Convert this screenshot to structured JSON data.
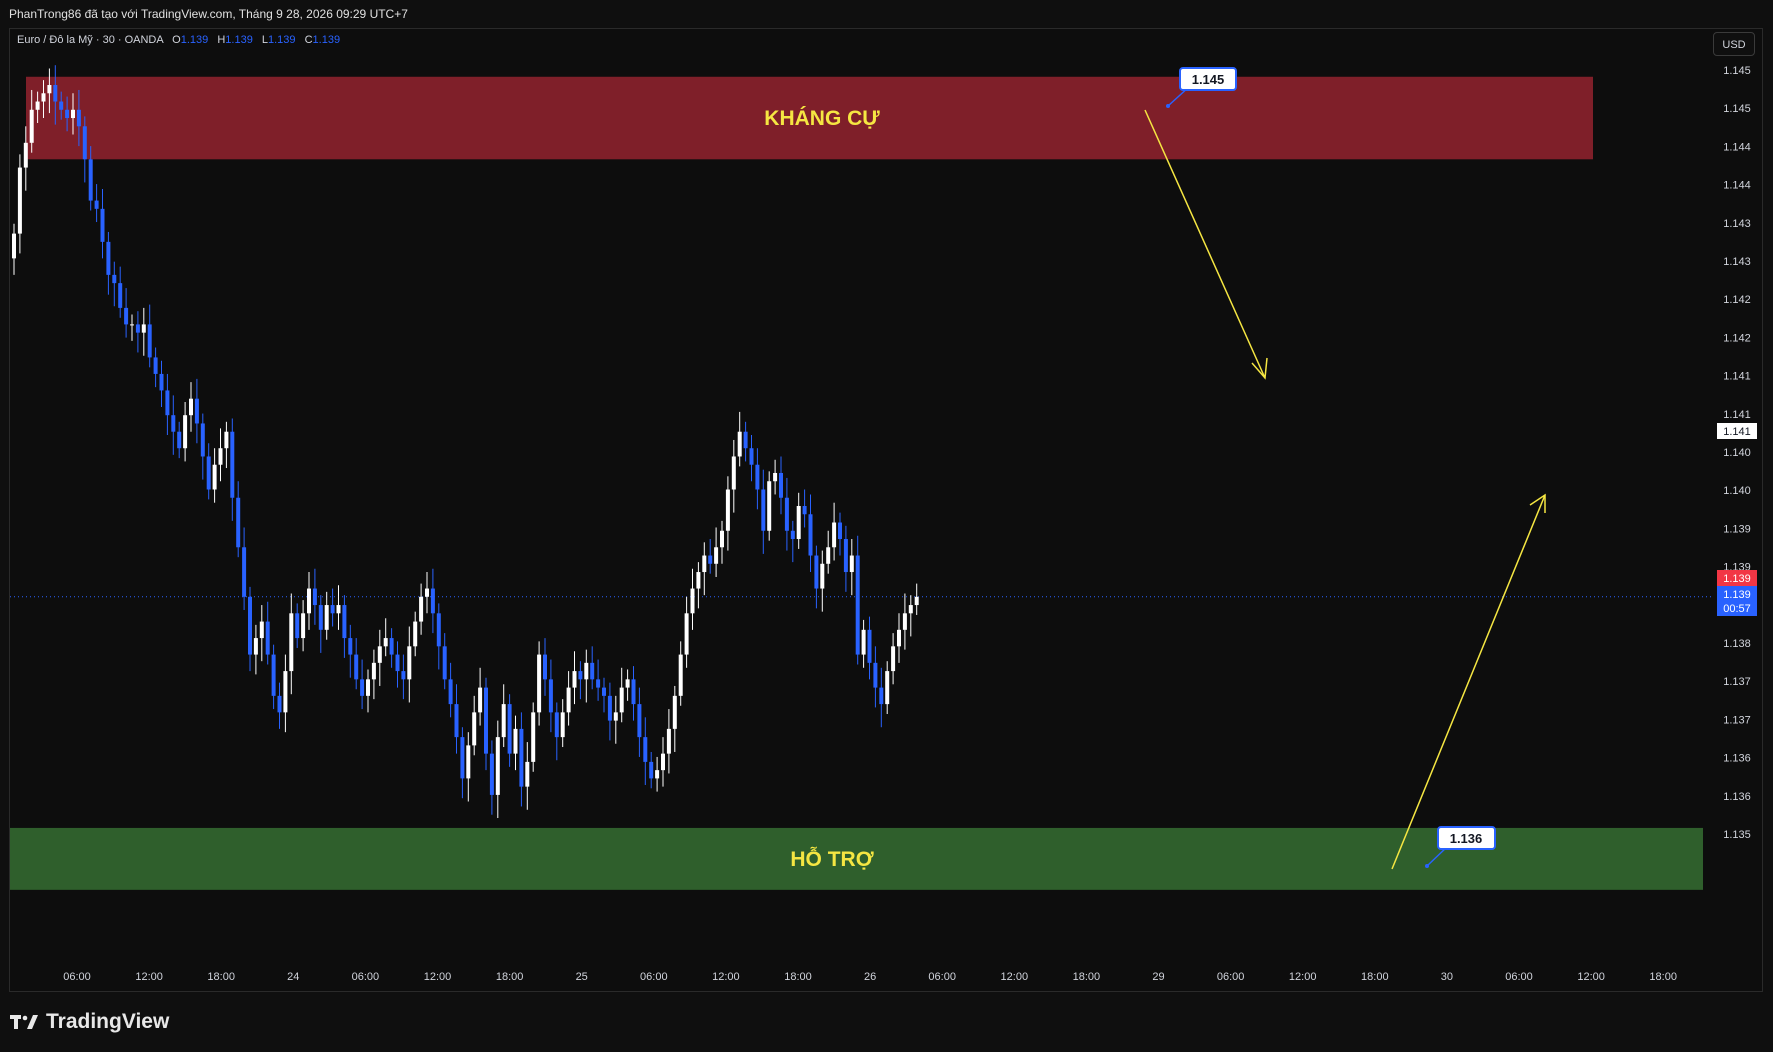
{
  "header": {
    "attribution": "PhanTrong86 đã tạo với TradingView.com, Tháng 9 28, 2026 09:29 UTC+7"
  },
  "legend": {
    "symbol": "Euro / Đô la Mỹ · 30 · OANDA",
    "o_label": "O",
    "o_value": "1.139",
    "h_label": "H",
    "h_value": "1.139",
    "l_label": "L",
    "l_value": "1.139",
    "c_label": "C",
    "c_value": "1.139"
  },
  "currency_button": "USD",
  "brand": "TradingView",
  "zones": {
    "resistance": {
      "label": "KHÁNG CỰ",
      "top": 1.1455,
      "bottom": 1.1445,
      "color": "#7f1f29"
    },
    "support": {
      "label": "HỖ TRỢ",
      "top": 1.1364,
      "bottom": 1.13565,
      "color": "#2f5f2c"
    }
  },
  "callouts": {
    "resistance_price": "1.145",
    "support_price": "1.136"
  },
  "price_scale": {
    "ticks": [
      "1.145",
      "1.145",
      "1.144",
      "1.144",
      "1.143",
      "1.143",
      "1.142",
      "1.142",
      "1.141",
      "1.141",
      "1.140",
      "1.140",
      "1.139",
      "1.139",
      "1.138",
      "1.138",
      "1.137",
      "1.137",
      "1.136",
      "1.136",
      "1.135"
    ],
    "crosshair_label": "1.141",
    "last_price_label": "1.139",
    "current_price_label": "1.139",
    "countdown": "00:57"
  },
  "time_scale": {
    "ticks": [
      "06:00",
      "12:00",
      "18:00",
      "24",
      "06:00",
      "12:00",
      "18:00",
      "25",
      "06:00",
      "12:00",
      "18:00",
      "26",
      "06:00",
      "12:00",
      "18:00",
      "29",
      "06:00",
      "12:00",
      "18:00",
      "30",
      "06:00",
      "12:00",
      "18:00"
    ]
  },
  "colors": {
    "up": "#ffffff",
    "down": "#2962ff",
    "arrow": "#f5e642",
    "zone_text": "#f5e642",
    "last_price_bg": "#f23645",
    "current_price_bg": "#2962ff"
  },
  "chart_data": {
    "type": "candlestick",
    "symbol": "EUR/USD",
    "timeframe": "30",
    "ylim": [
      1.1348,
      1.1458
    ],
    "closes": [
      1.1436,
      1.1444,
      1.1447,
      1.1451,
      1.1452,
      1.1453,
      1.1454,
      1.1452,
      1.1451,
      1.145,
      1.1451,
      1.1449,
      1.1445,
      1.144,
      1.1439,
      1.1435,
      1.1431,
      1.143,
      1.1427,
      1.1425,
      1.1425,
      1.1424,
      1.1425,
      1.1421,
      1.1419,
      1.1417,
      1.1414,
      1.1412,
      1.141,
      1.1414,
      1.1416,
      1.1413,
      1.1409,
      1.1405,
      1.1408,
      1.141,
      1.1412,
      1.1404,
      1.1398,
      1.1392,
      1.1385,
      1.1387,
      1.1389,
      1.1385,
      1.138,
      1.1378,
      1.1383,
      1.139,
      1.1387,
      1.139,
      1.1393,
      1.1391,
      1.1388,
      1.1391,
      1.139,
      1.1391,
      1.1387,
      1.1385,
      1.1382,
      1.138,
      1.1382,
      1.1384,
      1.1386,
      1.1387,
      1.1385,
      1.1383,
      1.1382,
      1.1386,
      1.1389,
      1.1392,
      1.1393,
      1.139,
      1.1386,
      1.1382,
      1.1379,
      1.1375,
      1.137,
      1.1374,
      1.1378,
      1.1381,
      1.1373,
      1.1368,
      1.1375,
      1.1379,
      1.1373,
      1.1376,
      1.1369,
      1.1372,
      1.1378,
      1.1385,
      1.1382,
      1.1378,
      1.1375,
      1.1378,
      1.1381,
      1.1383,
      1.1382,
      1.1384,
      1.1382,
      1.1381,
      1.138,
      1.1377,
      1.1378,
      1.1381,
      1.1382,
      1.1379,
      1.1375,
      1.1372,
      1.137,
      1.1371,
      1.1373,
      1.1376,
      1.138,
      1.1385,
      1.139,
      1.1393,
      1.1395,
      1.1397,
      1.1396,
      1.1398,
      1.14,
      1.1405,
      1.1409,
      1.1412,
      1.141,
      1.1408,
      1.1405,
      1.14,
      1.1406,
      1.1407,
      1.1404,
      1.14,
      1.1399,
      1.1403,
      1.1402,
      1.1397,
      1.1393,
      1.1396,
      1.1398,
      1.1401,
      1.1399,
      1.1395,
      1.1397,
      1.1385,
      1.1388,
      1.1384,
      1.1381,
      1.1379,
      1.1383,
      1.1386,
      1.1388,
      1.139,
      1.1391,
      1.1392
    ]
  }
}
